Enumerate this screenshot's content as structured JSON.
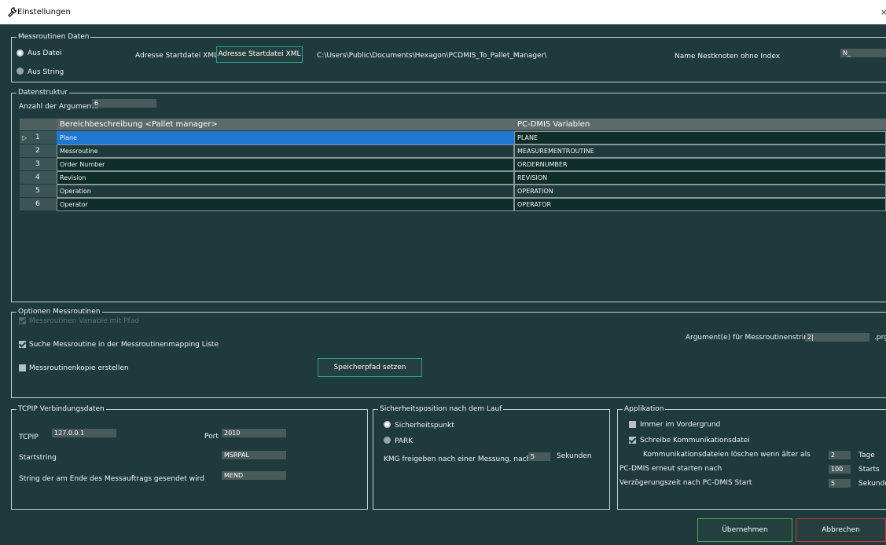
{
  "window": {
    "title": "Einstellungen"
  },
  "messroutinen_daten": {
    "legend": "Messroutinen Daten",
    "radio_datei": "Aus Datei",
    "radio_string": "Aus String",
    "adresse_label": "Adresse Startdatei XML",
    "adresse_button": "Adresse Startdatei XML",
    "path": "C:\\Users\\Public\\Documents\\Hexagon\\PCDMIS_To_Pallet_Manager\\",
    "nestknoten_label": "Name Nestknoten ohne Index",
    "nestknoten_value": "N_"
  },
  "datenstruktur": {
    "legend": "Datenstruktur",
    "anzahl_label": "Anzahl der Argumente",
    "anzahl_value": "6",
    "columns": [
      "Bereichbeschreibung <Pallet manager>",
      "PC-DMIS Variablen"
    ],
    "rows": [
      {
        "num": "1",
        "desc": "Plane",
        "var": "PLANE"
      },
      {
        "num": "2",
        "desc": "Messroutine",
        "var": "MEASUREMENTROUTINE"
      },
      {
        "num": "3",
        "desc": "Order Number",
        "var": "ORDERNUMBER"
      },
      {
        "num": "4",
        "desc": "Revision",
        "var": "REVISION"
      },
      {
        "num": "5",
        "desc": "Operation",
        "var": "OPERATION"
      },
      {
        "num": "6",
        "desc": "Operator",
        "var": "OPERATOR"
      }
    ]
  },
  "optionen": {
    "legend": "Optionen Messroutinen",
    "chk_variable": "Messroutinen Variable mit Pfad",
    "chk_suche": "Suche Messroutine in der Messroutinenmapping Liste",
    "chk_kopie": "Messroutinenkopie erstellen",
    "speicherpfad_button": "Speicherpfad setzen",
    "argument_label": "Argument(e) für Messroutinenstring",
    "argument_value": "2|",
    "ext": ".prg"
  },
  "tcpip": {
    "legend": "TCPIP Verbindungsdaten",
    "tcpip_label": "TCPIP",
    "tcpip_value": "127.0.0.1",
    "port_label": "Port",
    "port_value": "2010",
    "start_label": "Startstring",
    "start_value": "MSRPAL",
    "end_label": "String der am Ende des Messauftrags gesendet wird",
    "end_value": "MEND"
  },
  "sicherheit": {
    "legend": "Sicherheitsposition nach dem Lauf",
    "radio_punkt": "Sicherheitspunkt",
    "radio_park": "PARK",
    "kmg_label": "KMG freigeben nach einer Messung, nach",
    "kmg_value": "5",
    "kmg_unit": "Sekunden"
  },
  "applikation": {
    "legend": "Applikation",
    "chk_vordergrund": "Immer im Vordergrund",
    "chk_komm": "Schreibe Kommunikationsdatei",
    "loeschen_label": "Kommunikationsdateien löschen wenn älter als",
    "loeschen_value": "2",
    "loeschen_unit": "Tage",
    "neustart_label": "PC-DMIS erneut starten nach",
    "neustart_value": "100",
    "neustart_unit": "Starts",
    "verz_label": "Verzögerungszeit nach PC-DMIS Start",
    "verz_value": "5",
    "verz_unit": "Sekunden"
  },
  "buttons": {
    "ok": "Übernehmen",
    "cancel": "Abbrechen"
  },
  "colors": {
    "background": "#1f3a3c",
    "selection": "#1e78d2",
    "ok_border": "#4fa84f",
    "cancel_border": "#d03a3a"
  }
}
